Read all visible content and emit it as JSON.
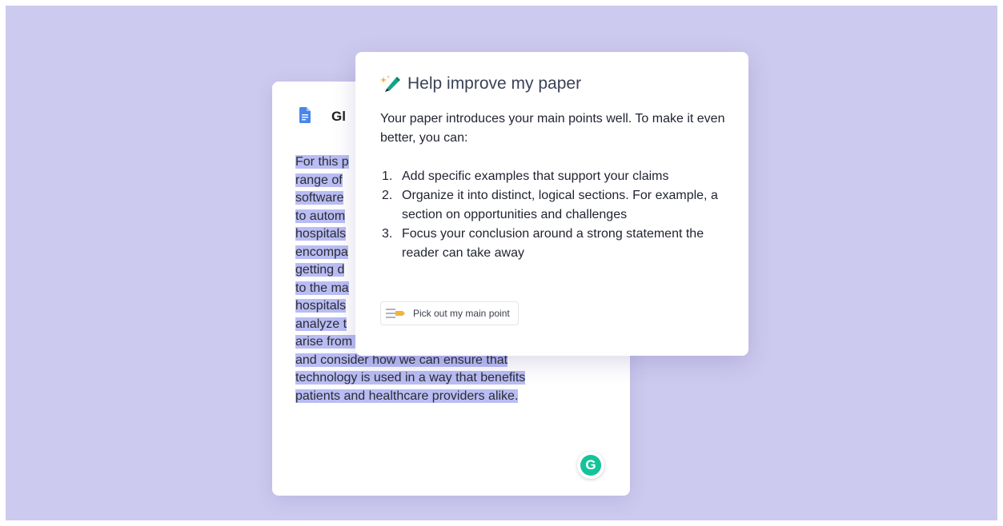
{
  "document": {
    "title": "Gl",
    "lines": [
      "For this p",
      "range of",
      "software",
      "to autom",
      "hospitals",
      "encompa",
      "getting d",
      "to the ma",
      "hospitals",
      "analyze t",
      "arise from the use of technology in this field,",
      "and consider how we can ensure that",
      "technology is used in a way that benefits",
      "patients and healthcare providers alike."
    ],
    "grammarly_letter": "G"
  },
  "popup": {
    "icon": "sparkle-pen-icon",
    "title": "Help improve my paper",
    "intro": "Your paper introduces your main points well. To make it even better, you can:",
    "items": [
      {
        "num": "1.",
        "text": "Add specific examples that support your claims"
      },
      {
        "num": "2.",
        "text": "Organize it into distinct, logical sections. For example, a section on opportunities and challenges"
      },
      {
        "num": "3.",
        "text": "Focus your conclusion around a strong statement the reader can take away"
      }
    ],
    "action_label": "Pick out my main point"
  },
  "colors": {
    "background": "#cdcaef",
    "highlight": "#b9bdf3",
    "grammarly": "#15c39a",
    "doc_icon": "#4a86e8"
  }
}
